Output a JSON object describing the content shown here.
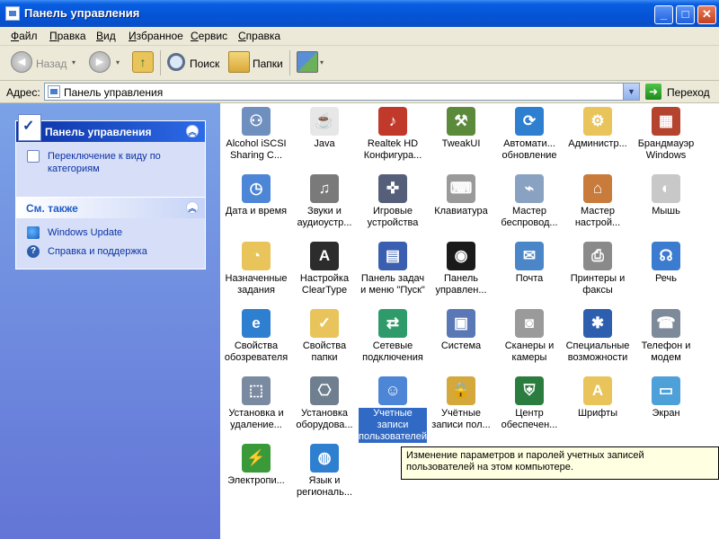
{
  "window": {
    "title": "Панель управления",
    "minimize": "_",
    "maximize": "□",
    "close": "✕"
  },
  "menu": [
    {
      "acc": "Ф",
      "rest": "айл"
    },
    {
      "acc": "П",
      "rest": "равка"
    },
    {
      "acc": "В",
      "rest": "ид"
    },
    {
      "acc": "И",
      "rest": "збранное"
    },
    {
      "acc": "С",
      "rest": "ервис"
    },
    {
      "acc": "С",
      "rest": "правка"
    }
  ],
  "toolbar": {
    "back_label": "Назад",
    "search_label": "Поиск",
    "folders_label": "Папки",
    "back_arrow": "◀",
    "forward_arrow": "▶",
    "up_arrow": "↑",
    "drop": "▾"
  },
  "address": {
    "label": "Адрес:",
    "value": "Панель управления",
    "drop": "▼",
    "go_arrow": "➜",
    "go_label": "Переход"
  },
  "taskpane": {
    "panel1": {
      "title": "Панель управления",
      "chevron": "︽",
      "link": "Переключение к виду по категориям"
    },
    "panel2": {
      "title": "См. также",
      "chevron": "︽",
      "links": [
        "Windows Update",
        "Справка и поддержка"
      ]
    }
  },
  "items": [
    {
      "label": "Alcohol iSCSI Sharing C...",
      "icon": "network-share-icon",
      "color": "#6f8fbf",
      "glyph": "⚇"
    },
    {
      "label": "Java",
      "icon": "java-icon",
      "color": "#e7e7e7",
      "glyph": "☕"
    },
    {
      "label": "Realtek HD Конфигура...",
      "icon": "speaker-icon",
      "color": "#c0392b",
      "glyph": "♪"
    },
    {
      "label": "TweakUI",
      "icon": "tweakui-icon",
      "color": "#5b8a3a",
      "glyph": "⚒"
    },
    {
      "label": "Автомати... обновление",
      "icon": "globe-shield-icon",
      "color": "#2f7fd1",
      "glyph": "⟳"
    },
    {
      "label": "Администр...",
      "icon": "admin-tools-icon",
      "color": "#e9c45a",
      "glyph": "⚙"
    },
    {
      "label": "Брандмауэр Windows",
      "icon": "firewall-icon",
      "color": "#b5442f",
      "glyph": "▦"
    },
    {
      "label": "Дата и время",
      "icon": "calendar-clock-icon",
      "color": "#4d86d6",
      "glyph": "◷"
    },
    {
      "label": "Звуки и аудиоустр...",
      "icon": "speaker-cone-icon",
      "color": "#7a7a7a",
      "glyph": "♫"
    },
    {
      "label": "Игровые устройства",
      "icon": "gamepad-icon",
      "color": "#555f7a",
      "glyph": "✜"
    },
    {
      "label": "Клавиатура",
      "icon": "keyboard-icon",
      "color": "#9a9a9a",
      "glyph": "⌨"
    },
    {
      "label": "Мастер беспровод...",
      "icon": "wireless-wizard-icon",
      "color": "#8aa2c2",
      "glyph": "⌁"
    },
    {
      "label": "Мастер настрой...",
      "icon": "network-wizard-icon",
      "color": "#c97b3b",
      "glyph": "⌂"
    },
    {
      "label": "Мышь",
      "icon": "mouse-icon",
      "color": "#c8c8c8",
      "glyph": "◐"
    },
    {
      "label": "Назначенные задания",
      "icon": "scheduled-tasks-icon",
      "color": "#e9c45a",
      "glyph": "◔"
    },
    {
      "label": "Настройка ClearType",
      "icon": "cleartype-icon",
      "color": "#2c2c2c",
      "glyph": "A"
    },
    {
      "label": "Панель задач и меню \"Пуск\"",
      "icon": "taskbar-icon",
      "color": "#3a5fb0",
      "glyph": "▤"
    },
    {
      "label": "Панель управлен...",
      "icon": "nvidia-icon",
      "color": "#1a1a1a",
      "glyph": "◉"
    },
    {
      "label": "Почта",
      "icon": "mail-icon",
      "color": "#4a86c8",
      "glyph": "✉"
    },
    {
      "label": "Принтеры и факсы",
      "icon": "printer-icon",
      "color": "#8a8a8a",
      "glyph": "⎙"
    },
    {
      "label": "Речь",
      "icon": "speech-icon",
      "color": "#3b7bd0",
      "glyph": "☊"
    },
    {
      "label": "Свойства обозревателя",
      "icon": "internet-options-icon",
      "color": "#2f7fd1",
      "glyph": "e"
    },
    {
      "label": "Свойства папки",
      "icon": "folder-options-icon",
      "color": "#e9c45a",
      "glyph": "✓"
    },
    {
      "label": "Сетевые подключения",
      "icon": "network-connections-icon",
      "color": "#2f9b6a",
      "glyph": "⇄"
    },
    {
      "label": "Система",
      "icon": "system-icon",
      "color": "#5a78b5",
      "glyph": "▣"
    },
    {
      "label": "Сканеры и камеры",
      "icon": "scanner-camera-icon",
      "color": "#9a9a9a",
      "glyph": "◙"
    },
    {
      "label": "Специальные возможности",
      "icon": "accessibility-icon",
      "color": "#2d5fae",
      "glyph": "✱"
    },
    {
      "label": "Телефон и модем",
      "icon": "phone-modem-icon",
      "color": "#7d8a99",
      "glyph": "☎"
    },
    {
      "label": "Установка и удаление...",
      "icon": "add-remove-programs-icon",
      "color": "#7a8aa0",
      "glyph": "⬚"
    },
    {
      "label": "Установка оборудова...",
      "icon": "add-hardware-icon",
      "color": "#6f7f8f",
      "glyph": "⎔"
    },
    {
      "label": "Учетные записи пользователей",
      "icon": "user-accounts-icon",
      "color": "#4d86d6",
      "glyph": "☺"
    },
    {
      "label": "Учётные записи пол...",
      "icon": "lock-icon",
      "color": "#d4a83a",
      "glyph": "🔒"
    },
    {
      "label": "Центр обеспечен...",
      "icon": "security-center-icon",
      "color": "#2a7d3e",
      "glyph": "⛨"
    },
    {
      "label": "Шрифты",
      "icon": "fonts-icon",
      "color": "#e9c45a",
      "glyph": "A"
    },
    {
      "label": "Экран",
      "icon": "display-icon",
      "color": "#4ea0d8",
      "glyph": "▭"
    },
    {
      "label": "Электропи...",
      "icon": "power-battery-icon",
      "color": "#3a9a3a",
      "glyph": "⚡"
    },
    {
      "label": "Язык и региональ...",
      "icon": "region-globe-icon",
      "color": "#2f7fd1",
      "glyph": "◍"
    }
  ],
  "tooltip": "Изменение параметров и паролей учетных записей пользователей на этом компьютере."
}
